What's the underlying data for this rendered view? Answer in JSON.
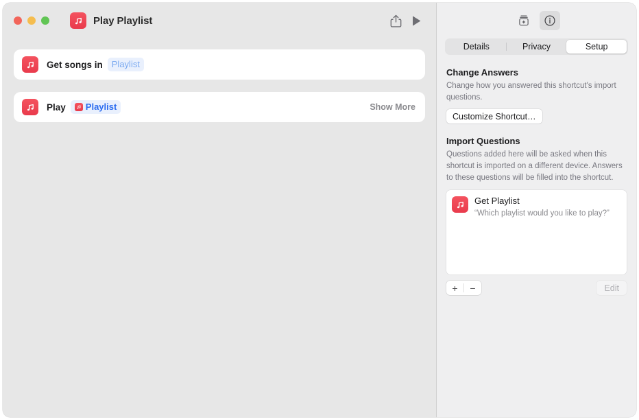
{
  "window": {
    "title": "Play Playlist",
    "app_icon": "music-note-icon",
    "traffic_lights": [
      {
        "name": "close",
        "color": "#f2655a"
      },
      {
        "name": "minimize",
        "color": "#f5bd4f"
      },
      {
        "name": "zoom",
        "color": "#61c554"
      }
    ],
    "toolbar": [
      {
        "name": "share-icon",
        "label": "Share"
      },
      {
        "name": "play-icon",
        "label": "Run"
      }
    ]
  },
  "editor": {
    "actions": [
      {
        "icon": "music-note-icon",
        "label": "Get songs in",
        "token": {
          "text": "Playlist",
          "style": "light",
          "icon": null
        },
        "trailing": null
      },
      {
        "icon": "music-note-icon",
        "label": "Play",
        "token": {
          "text": "Playlist",
          "style": "strong",
          "icon": "music-note-icon"
        },
        "trailing": "Show More"
      }
    ]
  },
  "inspector": {
    "buttons": [
      {
        "name": "add-to-gallery-icon",
        "selected": false
      },
      {
        "name": "info-icon",
        "selected": true
      }
    ],
    "tabs": [
      {
        "label": "Details",
        "selected": false
      },
      {
        "label": "Privacy",
        "selected": false
      },
      {
        "label": "Setup",
        "selected": true
      }
    ],
    "change_answers": {
      "title": "Change Answers",
      "body": "Change how you answered this shortcut's import questions.",
      "button": "Customize Shortcut…"
    },
    "import_questions": {
      "title": "Import Questions",
      "body": "Questions added here will be asked when this shortcut is imported on a different device. Answers to these questions will be filled into the shortcut.",
      "items": [
        {
          "icon": "music-note-icon",
          "title": "Get Playlist",
          "prompt": "“Which playlist would you like to play?”"
        }
      ],
      "footer": {
        "add": "+",
        "remove": "−",
        "edit": "Edit"
      }
    }
  },
  "colors": {
    "accent_red": "#e93b4c",
    "token_blue": "#2b6cf0",
    "token_blue_light": "#7aa9f0",
    "canvas": "#e7e7e7",
    "inspector_bg": "#efeff0"
  }
}
